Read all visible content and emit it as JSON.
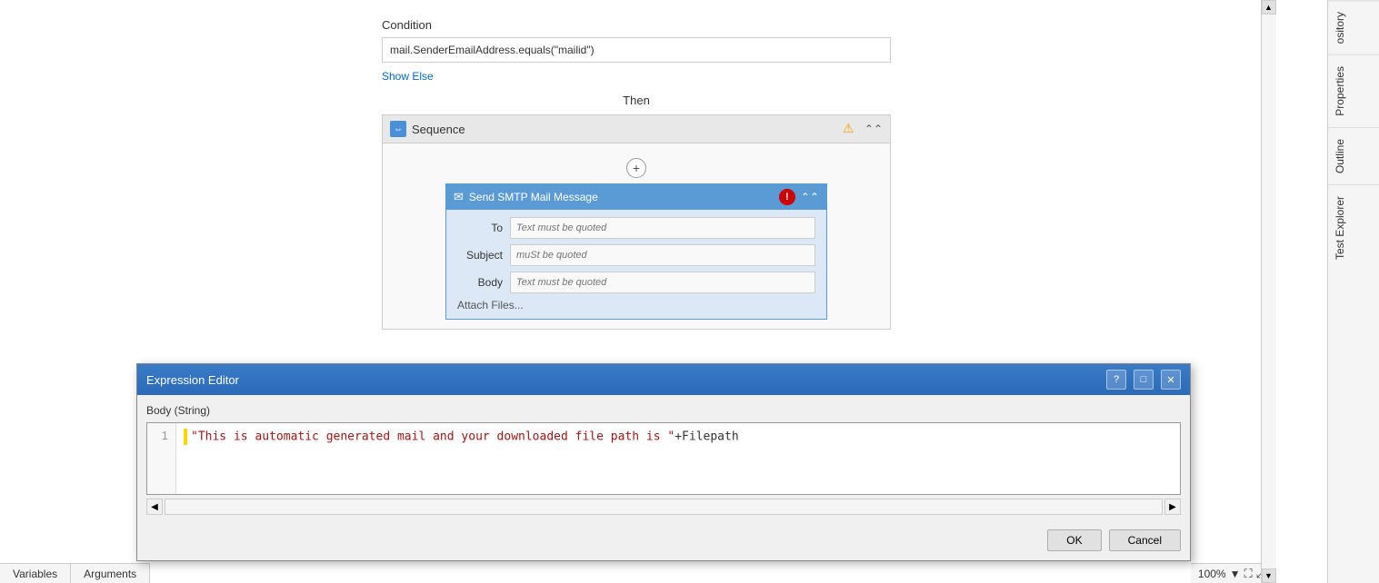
{
  "workflow": {
    "condition_label": "Condition",
    "condition_value": "mail.SenderEmailAddress.equals(\"mailid\")",
    "show_else": "Show Else",
    "then_label": "Then",
    "sequence_title": "Sequence",
    "add_button": "+",
    "smtp_title": "Send SMTP Mail Message",
    "fields": {
      "to_label": "To",
      "to_placeholder": "Text must be quoted",
      "subject_label": "Subject",
      "subject_placeholder": "muSt be quoted",
      "body_label": "Body",
      "body_placeholder": "Text must be quoted",
      "attach_files": "Attach Files..."
    }
  },
  "expression_editor": {
    "title": "Expression Editor",
    "help_btn": "?",
    "maximize_btn": "□",
    "close_btn": "✕",
    "field_label": "Body (String)",
    "line_number": "1",
    "code": "\"This is automatic generated mail and your downloaded file path is \"+Filepath",
    "code_string_part": "\"This is automatic generated mail and your downloaded file path is \"",
    "code_var_part": "+Filepath",
    "ok_label": "OK",
    "cancel_label": "Cancel"
  },
  "bottom": {
    "variables_tab": "Variables",
    "arguments_tab": "Arguments",
    "zoom_value": "100%"
  },
  "sidebar": {
    "tabs": [
      "ository",
      "Properties",
      "Outline",
      "Test Explorer"
    ]
  }
}
